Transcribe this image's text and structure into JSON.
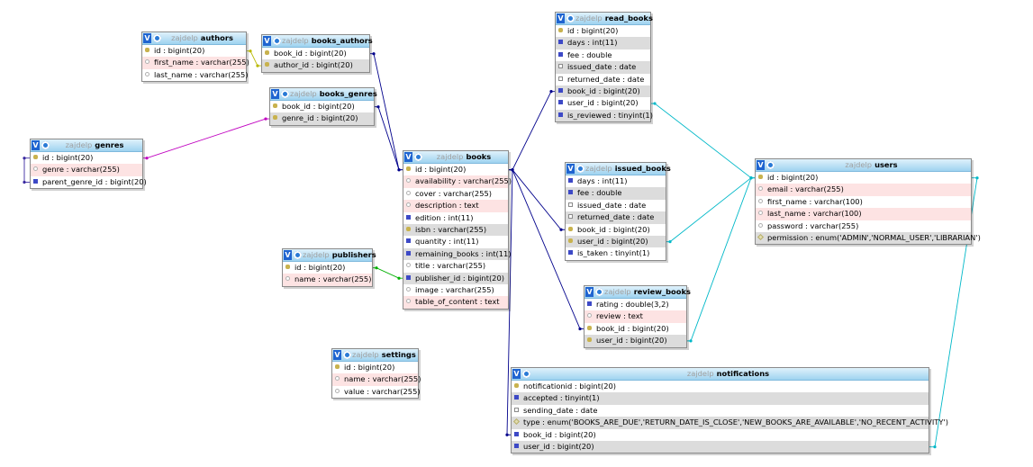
{
  "database": "zajdelp",
  "tables": [
    {
      "id": "authors",
      "name": "authors",
      "columns": [
        {
          "text": "id : bigint(20)",
          "icon": "primary-key-icon"
        },
        {
          "text": "first_name : varchar(255)",
          "icon": "text-column-icon"
        },
        {
          "text": "last_name : varchar(255)",
          "icon": "text-column-icon"
        }
      ]
    },
    {
      "id": "books_authors",
      "name": "books_authors",
      "columns": [
        {
          "text": "book_id : bigint(20)",
          "icon": "primary-key-icon"
        },
        {
          "text": "author_id : bigint(20)",
          "icon": "primary-key-icon"
        }
      ]
    },
    {
      "id": "books_genres",
      "name": "books_genres",
      "columns": [
        {
          "text": "book_id : bigint(20)",
          "icon": "primary-key-icon"
        },
        {
          "text": "genre_id : bigint(20)",
          "icon": "primary-key-icon"
        }
      ]
    },
    {
      "id": "genres",
      "name": "genres",
      "columns": [
        {
          "text": "id : bigint(20)",
          "icon": "primary-key-icon"
        },
        {
          "text": "genre : varchar(255)",
          "icon": "text-column-icon"
        },
        {
          "text": "parent_genre_id : bigint(20)",
          "icon": "numeric-column-icon"
        }
      ]
    },
    {
      "id": "publishers",
      "name": "publishers",
      "columns": [
        {
          "text": "id : bigint(20)",
          "icon": "primary-key-icon"
        },
        {
          "text": "name : varchar(255)",
          "icon": "text-column-icon"
        }
      ]
    },
    {
      "id": "settings",
      "name": "settings",
      "columns": [
        {
          "text": "id : bigint(20)",
          "icon": "primary-key-icon"
        },
        {
          "text": "name : varchar(255)",
          "icon": "text-column-icon"
        },
        {
          "text": "value : varchar(255)",
          "icon": "text-column-icon"
        }
      ]
    },
    {
      "id": "books",
      "name": "books",
      "columns": [
        {
          "text": "id : bigint(20)",
          "icon": "primary-key-icon"
        },
        {
          "text": "availability : varchar(255)",
          "icon": "text-column-icon"
        },
        {
          "text": "cover : varchar(255)",
          "icon": "text-column-icon"
        },
        {
          "text": "description : text",
          "icon": "text-column-icon"
        },
        {
          "text": "edition : int(11)",
          "icon": "numeric-column-icon"
        },
        {
          "text": "isbn : varchar(255)",
          "icon": "unique-key-icon"
        },
        {
          "text": "quantity : int(11)",
          "icon": "numeric-column-icon"
        },
        {
          "text": "remaining_books : int(11)",
          "icon": "numeric-column-icon"
        },
        {
          "text": "title : varchar(255)",
          "icon": "text-column-icon"
        },
        {
          "text": "publisher_id : bigint(20)",
          "icon": "numeric-column-icon"
        },
        {
          "text": "image : varchar(255)",
          "icon": "text-column-icon"
        },
        {
          "text": "table_of_content : text",
          "icon": "text-column-icon"
        }
      ]
    },
    {
      "id": "read_books",
      "name": "read_books",
      "columns": [
        {
          "text": "id : bigint(20)",
          "icon": "primary-key-icon"
        },
        {
          "text": "days : int(11)",
          "icon": "numeric-column-icon"
        },
        {
          "text": "fee : double",
          "icon": "numeric-column-icon"
        },
        {
          "text": "issued_date : date",
          "icon": "date-column-icon"
        },
        {
          "text": "returned_date : date",
          "icon": "date-column-icon"
        },
        {
          "text": "book_id : bigint(20)",
          "icon": "numeric-column-icon"
        },
        {
          "text": "user_id : bigint(20)",
          "icon": "numeric-column-icon"
        },
        {
          "text": "is_reviewed : tinyint(1)",
          "icon": "numeric-column-icon"
        }
      ]
    },
    {
      "id": "issued_books",
      "name": "issued_books",
      "columns": [
        {
          "text": "days : int(11)",
          "icon": "numeric-column-icon"
        },
        {
          "text": "fee : double",
          "icon": "numeric-column-icon"
        },
        {
          "text": "issued_date : date",
          "icon": "date-column-icon"
        },
        {
          "text": "returned_date : date",
          "icon": "date-column-icon"
        },
        {
          "text": "book_id : bigint(20)",
          "icon": "primary-key-icon"
        },
        {
          "text": "user_id : bigint(20)",
          "icon": "primary-key-icon"
        },
        {
          "text": "is_taken : tinyint(1)",
          "icon": "numeric-column-icon"
        }
      ]
    },
    {
      "id": "review_books",
      "name": "review_books",
      "columns": [
        {
          "text": "rating : double(3,2)",
          "icon": "numeric-column-icon"
        },
        {
          "text": "review : text",
          "icon": "text-column-icon"
        },
        {
          "text": "book_id : bigint(20)",
          "icon": "primary-key-icon"
        },
        {
          "text": "user_id : bigint(20)",
          "icon": "primary-key-icon"
        }
      ]
    },
    {
      "id": "users",
      "name": "users",
      "columns": [
        {
          "text": "id : bigint(20)",
          "icon": "primary-key-icon"
        },
        {
          "text": "email : varchar(255)",
          "icon": "text-column-icon"
        },
        {
          "text": "first_name : varchar(100)",
          "icon": "text-column-icon"
        },
        {
          "text": "last_name : varchar(100)",
          "icon": "text-column-icon"
        },
        {
          "text": "password : varchar(255)",
          "icon": "text-column-icon"
        },
        {
          "text": "permission : enum('ADMIN','NORMAL_USER','LIBRARIAN')",
          "icon": "enum-column-icon"
        }
      ]
    },
    {
      "id": "notifications",
      "name": "notifications",
      "columns": [
        {
          "text": "notificationid : bigint(20)",
          "icon": "primary-key-icon"
        },
        {
          "text": "accepted : tinyint(1)",
          "icon": "numeric-column-icon"
        },
        {
          "text": "sending_date : date",
          "icon": "date-column-icon"
        },
        {
          "text": "type : enum('BOOKS_ARE_DUE','RETURN_DATE_IS_CLOSE','NEW_BOOKS_ARE_AVAILABLE','NO_RECENT_ACTIVITY')",
          "icon": "enum-column-icon"
        },
        {
          "text": "book_id : bigint(20)",
          "icon": "numeric-column-icon"
        },
        {
          "text": "user_id : bigint(20)",
          "icon": "numeric-column-icon"
        }
      ]
    }
  ],
  "relations": [
    {
      "from": "books_authors.author_id",
      "to": "authors.id",
      "color": "#b8b800"
    },
    {
      "from": "books_authors.book_id",
      "to": "books.id",
      "color": "#00008b"
    },
    {
      "from": "books_genres.book_id",
      "to": "books.id",
      "color": "#00008b"
    },
    {
      "from": "books_genres.genre_id",
      "to": "genres.id",
      "color": "#c000c0"
    },
    {
      "from": "genres.parent_genre_id",
      "to": "genres.id",
      "color": "#3a2aa0"
    },
    {
      "from": "books.publisher_id",
      "to": "publishers.id",
      "color": "#00b000"
    },
    {
      "from": "read_books.book_id",
      "to": "books.id",
      "color": "#00008b"
    },
    {
      "from": "issued_books.book_id",
      "to": "books.id",
      "color": "#00008b"
    },
    {
      "from": "review_books.book_id",
      "to": "books.id",
      "color": "#00008b"
    },
    {
      "from": "notifications.book_id",
      "to": "books.id",
      "color": "#00008b"
    },
    {
      "from": "read_books.user_id",
      "to": "users.id",
      "color": "#00b8c8"
    },
    {
      "from": "issued_books.user_id",
      "to": "users.id",
      "color": "#00b8c8"
    },
    {
      "from": "review_books.user_id",
      "to": "users.id",
      "color": "#00b8c8"
    },
    {
      "from": "notifications.user_id",
      "to": "users.id",
      "color": "#00b8c8"
    }
  ],
  "toggle_label": "V",
  "colors": {
    "header_top": "#dff1fb",
    "header_bottom": "#9fd3f0",
    "alt_row": "#dcdcdc",
    "null_row": "#fde3e3"
  }
}
